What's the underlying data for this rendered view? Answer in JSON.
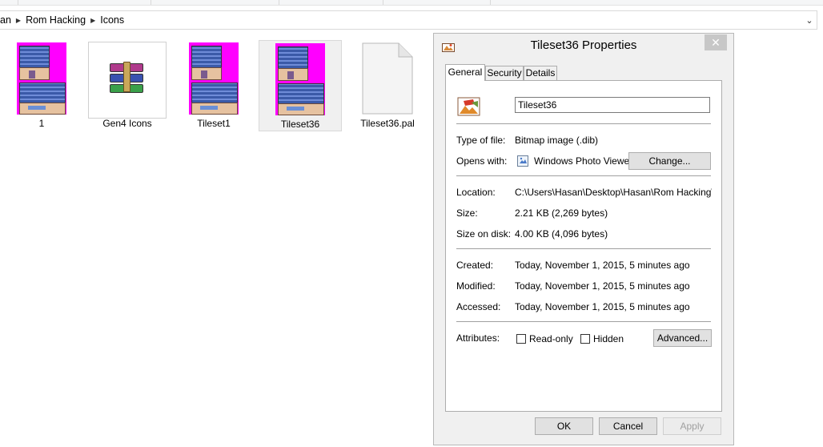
{
  "explorer": {
    "breadcrumb": [
      "an",
      "Rom Hacking",
      "Icons"
    ],
    "files": [
      {
        "name": "1",
        "icon": "bitmap-thumbnail-icon"
      },
      {
        "name": "Gen4 Icons",
        "icon": "winrar-archive-icon"
      },
      {
        "name": "Tileset1",
        "icon": "bitmap-thumbnail-icon"
      },
      {
        "name": "Tileset36",
        "icon": "bitmap-thumbnail-icon",
        "selected": true
      },
      {
        "name": "Tileset36.pal",
        "icon": "blank-file-icon"
      }
    ]
  },
  "dialog": {
    "title": "Tileset36 Properties",
    "close_glyph": "✕",
    "tabs": [
      {
        "label": "General",
        "active": true
      },
      {
        "label": "Security"
      },
      {
        "label": "Details"
      }
    ],
    "file_name": "Tileset36",
    "type_label": "Type of file:",
    "type_value": "Bitmap image (.dib)",
    "opens_label": "Opens with:",
    "opens_value": "Windows Photo Viewer",
    "change_button": "Change...",
    "location_label": "Location:",
    "location_value": "C:\\Users\\Hasan\\Desktop\\Hasan\\Rom Hacking\\Icons",
    "size_label": "Size:",
    "size_value": "2.21 KB (2,269 bytes)",
    "size_disk_label": "Size on disk:",
    "size_disk_value": "4.00 KB (4,096 bytes)",
    "created_label": "Created:",
    "created_value": "Today, November 1, 2015, 5 minutes ago",
    "modified_label": "Modified:",
    "modified_value": "Today, November 1, 2015, 5 minutes ago",
    "accessed_label": "Accessed:",
    "accessed_value": "Today, November 1, 2015, 5 minutes ago",
    "attributes_label": "Attributes:",
    "readonly_label": "Read-only",
    "hidden_label": "Hidden",
    "advanced_button": "Advanced...",
    "ok_button": "OK",
    "cancel_button": "Cancel",
    "apply_button": "Apply"
  }
}
